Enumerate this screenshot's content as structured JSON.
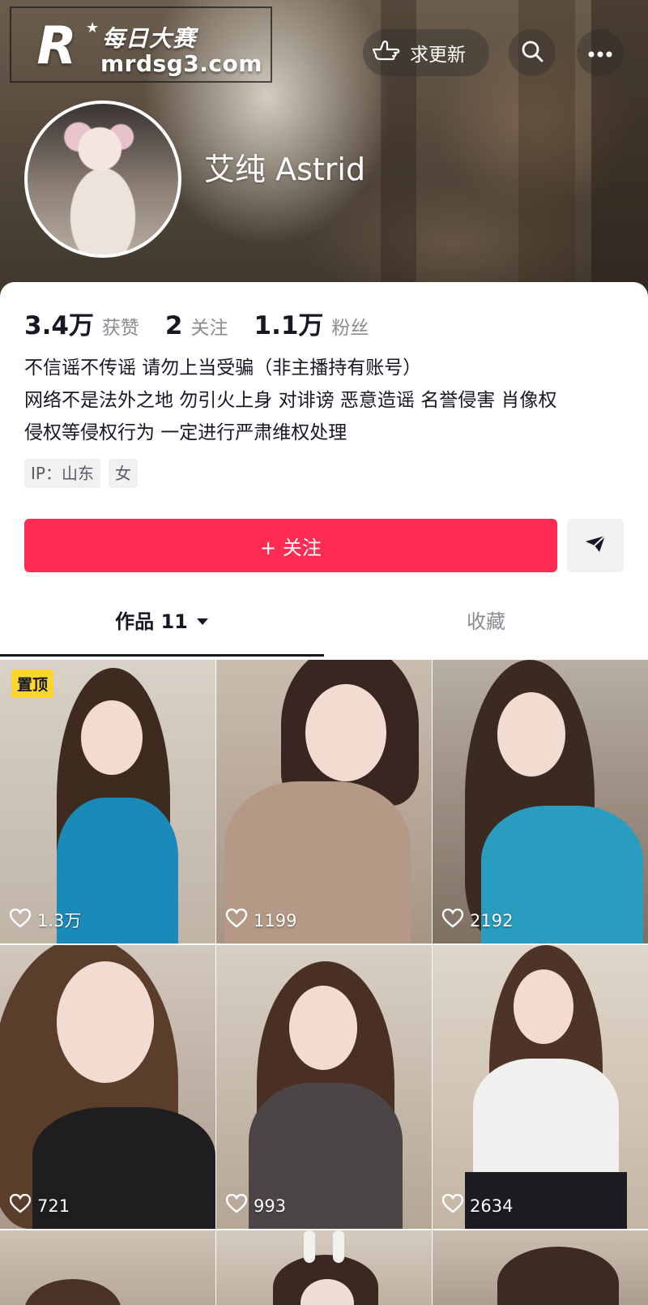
{
  "watermark": {
    "logo_letter": "R",
    "title": "每日大赛",
    "url": "mrdsg3.com"
  },
  "header": {
    "request_update_label": "求更新",
    "icons": [
      "hand-point-icon",
      "search-icon",
      "more-icon"
    ]
  },
  "profile": {
    "nickname": "艾纯 Astrid",
    "stats": [
      {
        "value": "3.4万",
        "label": "获赞"
      },
      {
        "value": "2",
        "label": "关注"
      },
      {
        "value": "1.1万",
        "label": "粉丝"
      }
    ],
    "bio_lines": [
      "不信谣不传谣 请勿上当受骗（非主播持有账号）",
      "网络不是法外之地 勿引火上身 对诽谤 恶意造谣 名誉侵害 肖像权",
      "侵权等侵权行为 一定进行严肃维权处理"
    ],
    "tags": [
      "IP：山东",
      "女"
    ],
    "follow_label": "+ 关注"
  },
  "tabs": {
    "works_label": "作品 11",
    "favorites_label": "收藏"
  },
  "videos": [
    {
      "likes": "1.3万",
      "pinned_label": "置顶"
    },
    {
      "likes": "1199"
    },
    {
      "likes": "2192"
    },
    {
      "likes": "721"
    },
    {
      "likes": "993"
    },
    {
      "likes": "2634"
    },
    {
      "likes": ""
    },
    {
      "likes": ""
    },
    {
      "likes": ""
    }
  ],
  "colors": {
    "accent": "#fe2c55",
    "pin_badge": "#fbd530",
    "text_primary": "#161823",
    "text_secondary": "#8a8b91"
  }
}
